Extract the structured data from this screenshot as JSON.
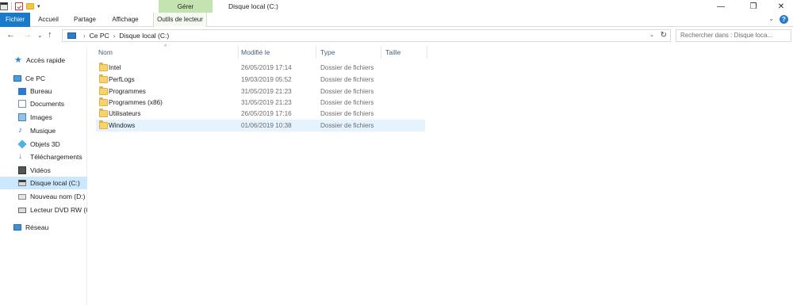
{
  "window": {
    "title": "Disque local (C:)",
    "context_tab": "Gérer",
    "controls": {
      "minimize": "—",
      "maximize": "❐",
      "close": "✕"
    }
  },
  "ribbon": {
    "tabs": [
      "Fichier",
      "Accueil",
      "Partage",
      "Affichage",
      "Outils de lecteur"
    ],
    "collapse": "⌄",
    "help": "?"
  },
  "nav": {
    "back": "←",
    "forward": "→",
    "recent": "⌄",
    "up": "↑",
    "breadcrumb": [
      "Ce PC",
      "Disque local (C:)"
    ],
    "crumb_separator": "›",
    "dropdown": "⌄",
    "refresh": "↻",
    "search_placeholder": "Rechercher dans : Disque loca..."
  },
  "sidebar": {
    "items": [
      {
        "label": "Accès rapide",
        "icon": "star-icon"
      },
      {
        "label": "Ce PC",
        "icon": "computer-icon"
      },
      {
        "label": "Bureau",
        "icon": "desktop-icon"
      },
      {
        "label": "Documents",
        "icon": "documents-icon"
      },
      {
        "label": "Images",
        "icon": "pictures-icon"
      },
      {
        "label": "Musique",
        "icon": "music-icon"
      },
      {
        "label": "Objets 3D",
        "icon": "3d-objects-icon"
      },
      {
        "label": "Téléchargements",
        "icon": "downloads-icon"
      },
      {
        "label": "Vidéos",
        "icon": "videos-icon"
      },
      {
        "label": "Disque local (C:)",
        "icon": "drive-icon",
        "selected": true
      },
      {
        "label": "Nouveau nom (D:)",
        "icon": "drive-icon"
      },
      {
        "label": "Lecteur DVD RW (G:",
        "icon": "dvd-drive-icon"
      },
      {
        "label": "Réseau",
        "icon": "network-icon"
      }
    ]
  },
  "columns": [
    "Nom",
    "Modifié le",
    "Type",
    "Taille"
  ],
  "sort_indicator": "^",
  "files": [
    {
      "name": "Intel",
      "modified": "26/05/2019 17:14",
      "type": "Dossier de fichiers"
    },
    {
      "name": "PerfLogs",
      "modified": "19/03/2019 05:52",
      "type": "Dossier de fichiers"
    },
    {
      "name": "Programmes",
      "modified": "31/05/2019 21:23",
      "type": "Dossier de fichiers"
    },
    {
      "name": "Programmes (x86)",
      "modified": "31/05/2019 21:23",
      "type": "Dossier de fichiers"
    },
    {
      "name": "Utilisateurs",
      "modified": "26/05/2019 17:16",
      "type": "Dossier de fichiers"
    },
    {
      "name": "Windows",
      "modified": "01/06/2019 10:38",
      "type": "Dossier de fichiers",
      "selected": true
    }
  ],
  "colors": {
    "accent": "#1979ca",
    "context_tab": "#c3e3b0",
    "selection": "#cce8ff",
    "row_hover": "#e5f3ff",
    "folder": "#f8d26a"
  }
}
